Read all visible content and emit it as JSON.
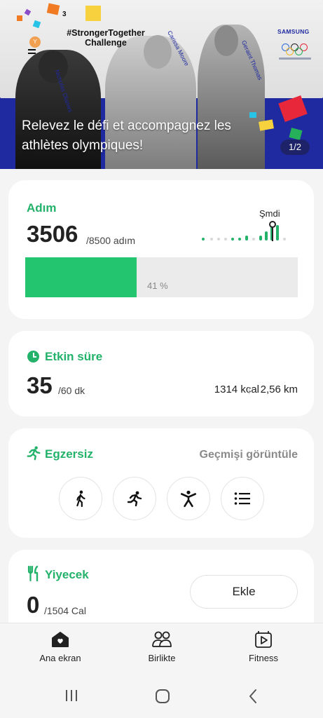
{
  "banner": {
    "challenge_title_1": "#StrongerTogether",
    "challenge_title_2": "Challenge",
    "athlete_1": "Nicholas Dlamini",
    "athlete_2": "Carissa Moore",
    "athlete_3": "Geraint Thomas",
    "brand": "SAMSUNG",
    "notification_count": "3",
    "avatar_initial": "Y",
    "headline": "Relevez le défi et accompagnez les athlètes olympiques!",
    "pager": "1/2"
  },
  "steps": {
    "title": "Adım",
    "value": "3506",
    "goal": "/8500 adım",
    "now_label": "Şmdi",
    "progress": 0.41,
    "percent_label": "41 %"
  },
  "active_time": {
    "title": "Etkin süre",
    "value": "35",
    "goal": "/60 dk",
    "calories": "1314 kcal",
    "distance": "2,56 km"
  },
  "exercise": {
    "title": "Egzersiz",
    "history_link": "Geçmişi görüntüle"
  },
  "food": {
    "title": "Yiyecek",
    "value": "0",
    "goal": "/1504 Cal",
    "add_label": "Ekle"
  },
  "nav": {
    "home": "Ana ekran",
    "together": "Birlikte",
    "fitness": "Fitness"
  },
  "colors": {
    "accent": "#23b26a",
    "progress_fill": "#23c66f",
    "banner_blue": "#1f2aa0"
  }
}
